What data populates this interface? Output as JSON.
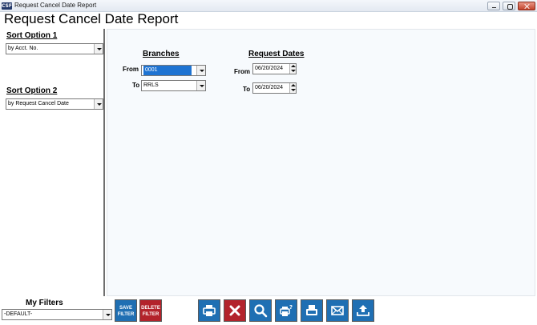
{
  "window": {
    "title": "Request Cancel Date Report",
    "icon_text": "CSF"
  },
  "report": {
    "title": "Request Cancel Date Report"
  },
  "sort_option_1": {
    "label": "Sort Option 1",
    "value": "by Acct. No."
  },
  "sort_option_2": {
    "label": "Sort Option 2",
    "value": "by Request Cancel Date"
  },
  "branches": {
    "header": "Branches",
    "from_label": "From",
    "from_value": "0001",
    "to_label": "To",
    "to_value": "RRLS"
  },
  "request_dates": {
    "header": "Request Dates",
    "from_label": "From",
    "from_value": "06/20/2024",
    "to_label": "To",
    "to_value": "06/20/2024"
  },
  "filters": {
    "label": "My Filters",
    "value": "-DEFAULT-"
  },
  "toolbar": {
    "save_filter_line1": "SAVE",
    "save_filter_line2": "FILTER",
    "delete_filter_line1": "DELETE",
    "delete_filter_line2": "FILTER",
    "icons": [
      "printer-icon",
      "close-icon",
      "search-icon",
      "print-preview-icon",
      "fax-icon",
      "email-icon",
      "upload-icon"
    ]
  },
  "colors": {
    "toolbar_blue": "#1f6fb3",
    "toolbar_red": "#b3232b",
    "selection": "#1e73d2"
  }
}
